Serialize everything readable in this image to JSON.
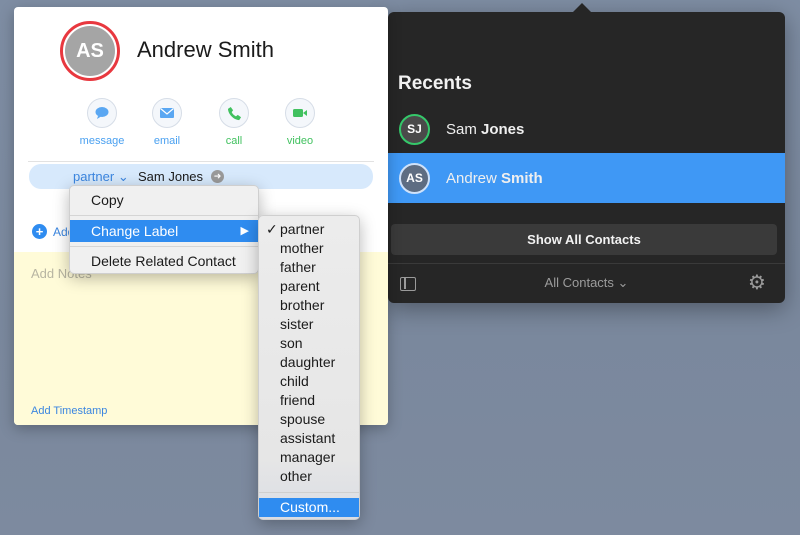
{
  "recents": {
    "title": "Recents",
    "items": [
      {
        "initials": "SJ",
        "first": "Sam",
        "last": "Jones"
      },
      {
        "initials": "AS",
        "first": "Andrew",
        "last": "Smith"
      }
    ],
    "show_all_label": "Show All Contacts",
    "footer_label": "All Contacts",
    "footer_chevron": "⌄"
  },
  "card": {
    "initials": "AS",
    "name": "Andrew Smith",
    "actions": [
      {
        "label": "message",
        "icon": "message-icon"
      },
      {
        "label": "email",
        "icon": "email-icon"
      },
      {
        "label": "call",
        "icon": "phone-icon"
      },
      {
        "label": "video",
        "icon": "video-icon"
      }
    ],
    "related": {
      "label": "partner",
      "chevron": "⌄",
      "value": "Sam Jones"
    },
    "add_field_label": "Add",
    "notes_placeholder": "Add Notes",
    "timestamp_label": "Add Timestamp"
  },
  "context_menu": {
    "items": [
      "Copy",
      "Change Label",
      "Delete Related Contact"
    ],
    "submenu_arrow": "▶"
  },
  "label_submenu": {
    "selected": "partner",
    "checkmark": "✓",
    "options": [
      "partner",
      "mother",
      "father",
      "parent",
      "brother",
      "sister",
      "son",
      "daughter",
      "child",
      "friend",
      "spouse",
      "assistant",
      "manager",
      "other"
    ],
    "custom": "Custom..."
  },
  "colors": {
    "accent": "#2f8cf0",
    "selection": "#3f98f5",
    "avatar_ring": "#e8383f",
    "call_green": "#41c15f",
    "notes_bg": "#fffbd8"
  }
}
